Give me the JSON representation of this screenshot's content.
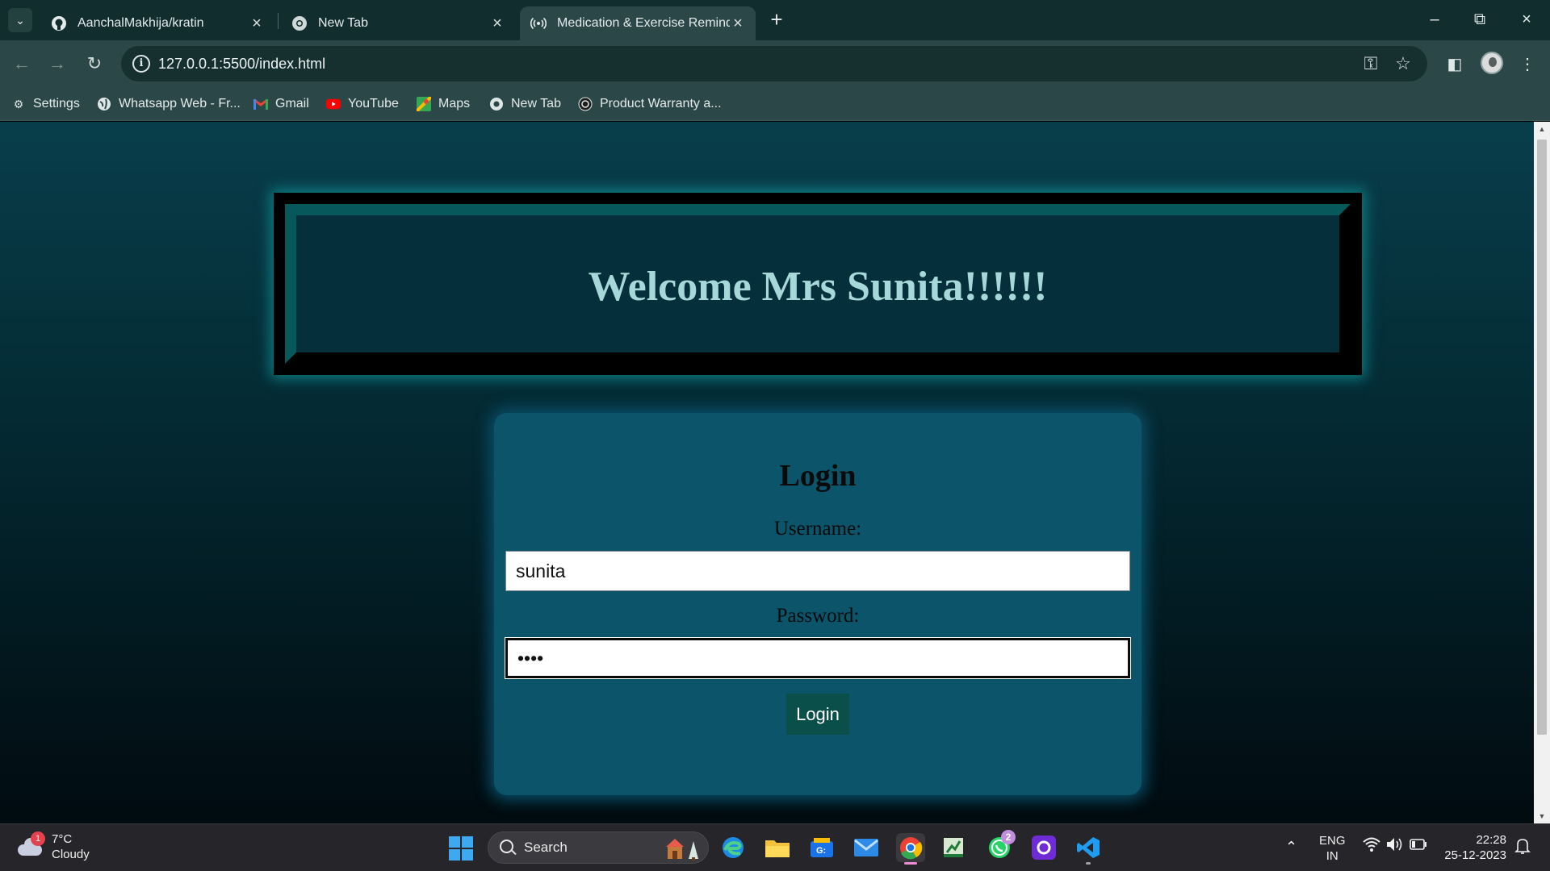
{
  "browser": {
    "tabs": [
      {
        "title": "AanchalMakhija/kratin",
        "icon": "github-icon",
        "active": false
      },
      {
        "title": "New Tab",
        "icon": "chrome-icon",
        "active": false
      },
      {
        "title": "Medication & Exercise Reminde",
        "icon": "broadcast-icon",
        "active": true
      }
    ],
    "url": "127.0.0.1:5500/index.html",
    "bookmarks": [
      {
        "label": "Settings",
        "icon": "gear-icon"
      },
      {
        "label": "Whatsapp Web - Fr...",
        "icon": "globe-icon"
      },
      {
        "label": "Gmail",
        "icon": "gmail-icon"
      },
      {
        "label": "YouTube",
        "icon": "youtube-icon"
      },
      {
        "label": "Maps",
        "icon": "maps-icon"
      },
      {
        "label": "New Tab",
        "icon": "chrome-icon"
      },
      {
        "label": "Product Warranty a...",
        "icon": "spiral-icon"
      }
    ]
  },
  "page": {
    "welcome_heading": "Welcome Mrs Sunita!!!!!!",
    "login": {
      "title": "Login",
      "username_label": "Username:",
      "username_value": "sunita",
      "password_label": "Password:",
      "password_value": "••••",
      "button_label": "Login"
    }
  },
  "taskbar": {
    "weather": {
      "temp": "7°C",
      "condition": "Cloudy",
      "badge": "1"
    },
    "search_label": "Search",
    "whatsapp_badge": "2",
    "language": {
      "line1": "ENG",
      "line2": "IN"
    },
    "clock": {
      "time": "22:28",
      "date": "25-12-2023"
    }
  },
  "colors": {
    "accent_teal": "#0c5469",
    "heading_text": "#a6d8d9",
    "button_bg": "#0a4f4a"
  }
}
